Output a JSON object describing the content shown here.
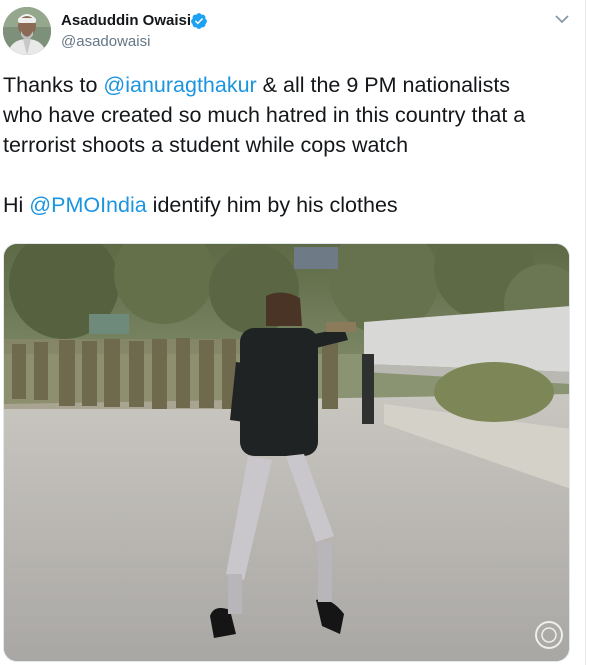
{
  "tweet": {
    "author_name": "Asaduddin Owaisi",
    "handle": "@asadowaisi",
    "verified_icon": "verified-badge-icon",
    "menu_icon": "chevron-down-icon",
    "text": {
      "l1_a": "Thanks to ",
      "l1_mention": "@ianuragthakur",
      "l1_b": " & all the 9 PM nationalists",
      "l2": "who have created so much hatred in this country that a",
      "l3": "terrorist shoots a student while cops watch",
      "l5_a": "Hi ",
      "l5_mention": "@PMOIndia",
      "l5_b": " identify him by his clothes"
    },
    "media": {
      "type": "photo",
      "watermark_icon": "watermark-seal-icon"
    }
  },
  "colors": {
    "link": "#1b95e0",
    "verified": "#1da1f2",
    "text": "#14171a",
    "secondary": "#657786"
  }
}
